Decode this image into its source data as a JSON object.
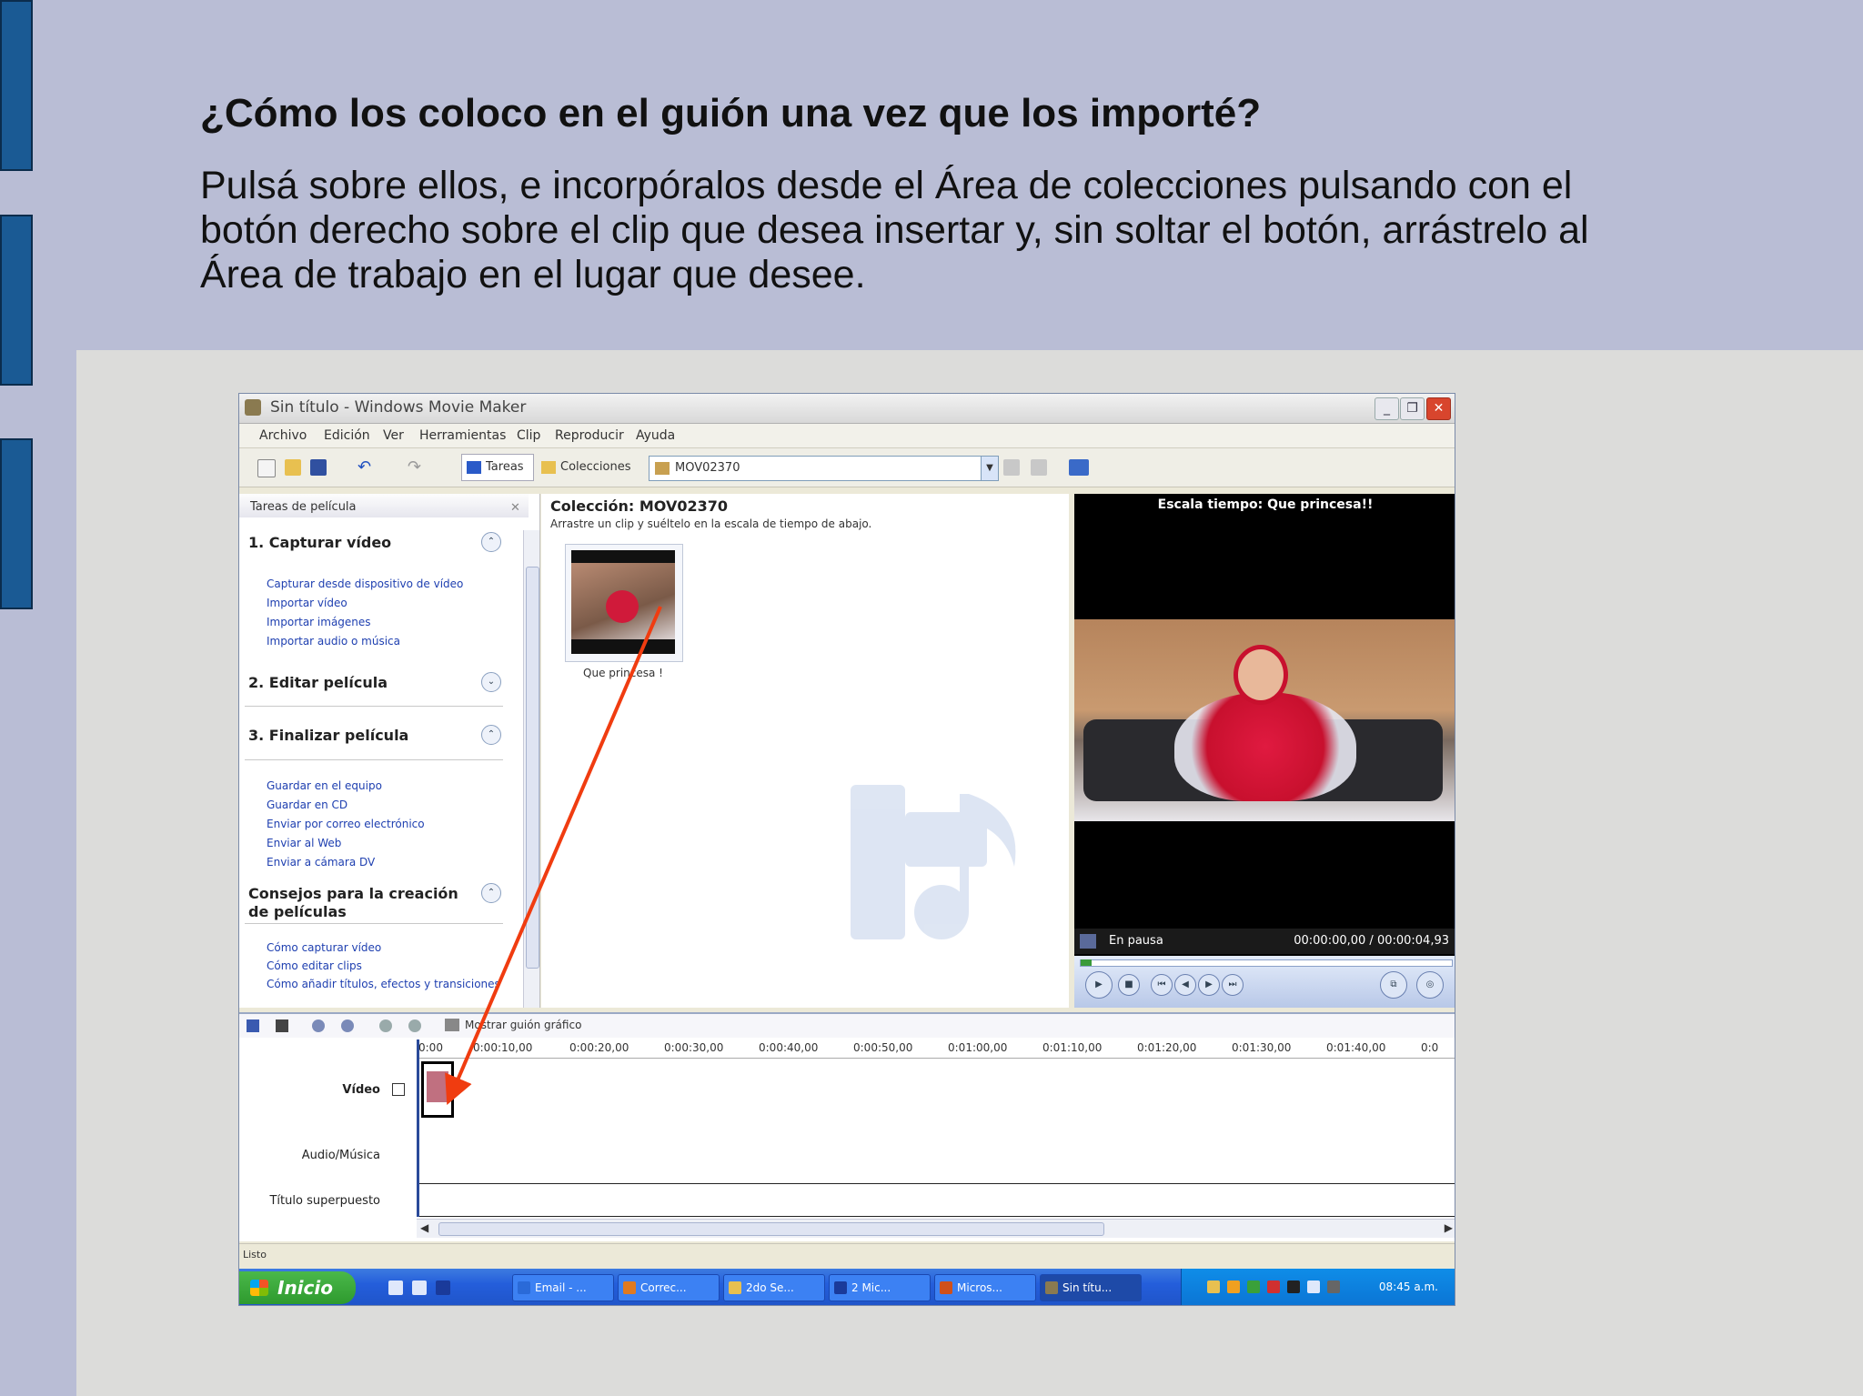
{
  "slide": {
    "title": "¿Cómo los coloco en el guión una vez que los importé?",
    "body": "Pulsá sobre ellos, e incorpóralos desde el Área de colecciones pulsando con el botón derecho sobre el clip que desea insertar y, sin soltar el botón, arrástrelo al Área de trabajo en el lugar que desee."
  },
  "window": {
    "title": "Sin título - Windows Movie Maker",
    "menu": [
      "Archivo",
      "Edición",
      "Ver",
      "Herramientas",
      "Clip",
      "Reproducir",
      "Ayuda"
    ],
    "toolbar": {
      "tasks_label": "Tareas",
      "collections_label": "Colecciones",
      "collection_select": "MOV02370"
    }
  },
  "tasks_pane": {
    "header": "Tareas de película",
    "sections": [
      {
        "title": "1. Capturar vídeo",
        "links": [
          "Capturar desde dispositivo de vídeo",
          "Importar vídeo",
          "Importar imágenes",
          "Importar audio o música"
        ]
      },
      {
        "title": "2. Editar película",
        "links": []
      },
      {
        "title": "3. Finalizar película",
        "links": [
          "Guardar en el equipo",
          "Guardar en CD",
          "Enviar por correo electrónico",
          "Enviar al Web",
          "Enviar a cámara DV"
        ]
      },
      {
        "title": "Consejos para la creación de películas",
        "links": [
          "Cómo capturar vídeo",
          "Cómo editar clips",
          "Cómo añadir títulos, efectos y transiciones"
        ]
      }
    ]
  },
  "collection": {
    "title": "Colección: MOV02370",
    "hint": "Arrastre un clip y suéltelo en la escala de tiempo de abajo.",
    "clip_label": "Que princesa !"
  },
  "preview": {
    "title": "Escala tiempo: Que princesa!!",
    "status": "En pausa",
    "time": "00:00:00,00 / 00:00:04,93"
  },
  "timeline": {
    "show_storyboard": "Mostrar guión gráfico",
    "ticks": [
      "0:00",
      "0:00:10,00",
      "0:00:20,00",
      "0:00:30,00",
      "0:00:40,00",
      "0:00:50,00",
      "0:01:00,00",
      "0:01:10,00",
      "0:01:20,00",
      "0:01:30,00",
      "0:01:40,00",
      "0:0"
    ],
    "tracks": {
      "video": "Vídeo",
      "audio": "Audio/Música",
      "title": "Título superpuesto"
    }
  },
  "status_bar": "Listo",
  "taskbar": {
    "start": "Inicio",
    "tasks": [
      "Email - ...",
      "Correc...",
      "2do Se...",
      "2 Mic...",
      "Micros...",
      "Sin títu..."
    ],
    "clock": "08:45 a.m."
  },
  "colors": {
    "slide_bg": "#b9bdd5",
    "panel_bg": "#dcdcda",
    "accent_arrow": "#f03c10",
    "side_tabs": "#1a5a94"
  }
}
